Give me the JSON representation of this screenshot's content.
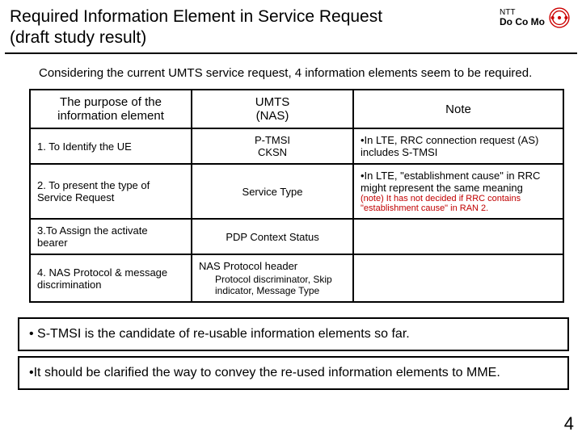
{
  "header": {
    "title_l1": "Required Information Element in Service Request",
    "title_l2": "(draft study result)",
    "logo": {
      "ntt": "NTT",
      "brand": "Do Co Mo"
    }
  },
  "intro": "Considering the current UMTS service request, 4 information elements seem to be required.",
  "table": {
    "head": {
      "purpose": "The purpose of the\ninformation element",
      "umts_l1": "UMTS",
      "umts_l2": "(NAS)",
      "note": "Note"
    },
    "row1": {
      "purpose": "1. To Identify the UE",
      "umts_l1": "P-TMSI",
      "umts_l2": "CKSN",
      "note": "•In LTE, RRC connection request (AS) includes S-TMSI"
    },
    "row2": {
      "purpose": "2. To present the type of\n   Service Request",
      "umts": "Service Type",
      "note_main": "•In LTE, \"establishment cause\" in RRC might represent the same meaning",
      "note_sub": "(note) It has not decided if RRC contains \"establishment cause\" in RAN 2."
    },
    "row3": {
      "purpose": "3.To Assign the activate\n   bearer",
      "umts": "PDP Context Status",
      "note": ""
    },
    "row4": {
      "purpose": "4. NAS Protocol & message\n   discrimination",
      "umts_main": "NAS Protocol header",
      "umts_sub": "Protocol discriminator, Skip indicator, Message Type",
      "note": ""
    }
  },
  "box1": "• S-TMSI is the candidate of re-usable information elements so far.",
  "box2": "•It should be clarified the way to convey the re-used information elements to MME.",
  "page_number": "4"
}
